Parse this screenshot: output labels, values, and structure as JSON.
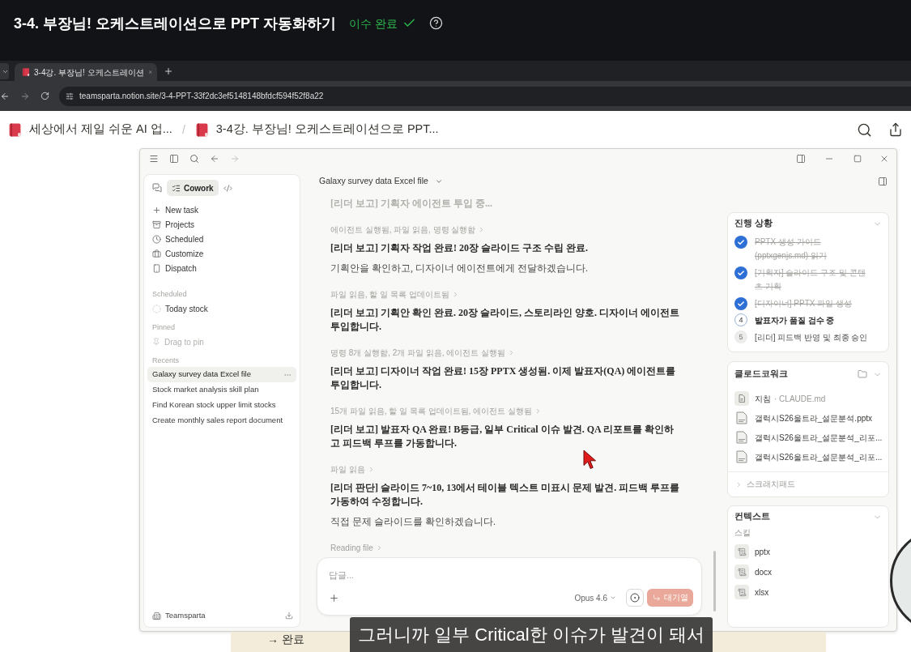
{
  "course_header": {
    "title": "3-4. 부장님! 오케스트레이션으로 PPT 자동화하기",
    "status": "이수 완료",
    "completed": true
  },
  "browser": {
    "tabs": [
      {
        "title": "3-4강. 부장님! 오케스트레이션",
        "selected": true
      }
    ],
    "url": "teamsparta.notion.site/3-4-PPT-33f2dc3ef5148148bfdcf594f52f8a22"
  },
  "notion_topbar": {
    "breadcrumbs": [
      "세상에서 제일 쉬운 AI 업...",
      "3-4강. 부장님! 오케스트레이션으로 PPT..."
    ],
    "separator": "/"
  },
  "app_sidebar": {
    "modes": [
      {
        "kind": "chat",
        "selected": false
      },
      {
        "kind": "cowork",
        "label": "Cowork",
        "selected": true
      },
      {
        "kind": "code",
        "selected": false
      }
    ],
    "nav": [
      "New task",
      "Projects",
      "Scheduled",
      "Customize",
      "Dispatch"
    ],
    "scheduled": {
      "heading": "Scheduled",
      "items": [
        "Today stock"
      ]
    },
    "pinned": {
      "heading": "Pinned",
      "hint": "Drag to pin"
    },
    "recents": {
      "heading": "Recents",
      "items": [
        {
          "label": "Galaxy survey data Excel file",
          "selected": true
        },
        {
          "label": "Stock market analysis skill plan",
          "selected": false
        },
        {
          "label": "Find Korean stock upper limit stocks",
          "selected": false
        },
        {
          "label": "Create monthly sales report document",
          "selected": false
        }
      ]
    },
    "workspace": "Teamsparta"
  },
  "chat": {
    "title": "Galaxy survey data Excel file",
    "messages": [
      {
        "kind": "faded",
        "text": "[리더 보고] 기획자 에이전트 투입 중..."
      },
      {
        "kind": "activity",
        "text": "에이전트 실행됨, 파일 읽음, 명령 실행함"
      },
      {
        "kind": "bold",
        "text": "[리더 보고] 기획자 작업 완료! 20장 슬라이드 구조 수립 완료."
      },
      {
        "kind": "plain",
        "text": "기획안을 확인하고, 디자이너 에이전트에게 전달하겠습니다."
      },
      {
        "kind": "activity",
        "text": "파일 읽음, 할 일 목록 업데이트됨"
      },
      {
        "kind": "bold",
        "text": "[리더 보고] 기획안 확인 완료. 20장 슬라이드, 스토리라인 양호. 디자이너 에이전트 투입합니다."
      },
      {
        "kind": "activity",
        "text": "명령 8개 실행함, 2개 파일 읽음, 에이전트 실행됨"
      },
      {
        "kind": "bold",
        "text": "[리더 보고] 디자이너 작업 완료! 15장 PPTX 생성됨. 이제 발표자(QA) 에이전트를 투입합니다."
      },
      {
        "kind": "activity",
        "text": "15개 파일 읽음, 할 일 목록 업데이트됨, 에이전트 실행됨"
      },
      {
        "kind": "bold",
        "text": "[리더 보고] 발표자 QA 완료! B등급, 일부 Critical 이슈 발견. QA 리포트를 확인하고 피드백 루프를 가동합니다."
      },
      {
        "kind": "activity",
        "text": "파일 읽음"
      },
      {
        "kind": "bold",
        "text": "[리더 판단] 슬라이드 7~10, 13에서 테이블 텍스트 미표시 문제 발견. 피드백 루프를 가동하여 수정합니다."
      },
      {
        "kind": "plain",
        "text": "직접 문제 슬라이드를 확인하겠습니다."
      },
      {
        "kind": "activity",
        "text": "Reading file"
      }
    ],
    "composer": {
      "placeholder": "답글...",
      "model": "Opus 4.6",
      "queue_button": "대기열"
    }
  },
  "side_panel": {
    "progress": {
      "title": "진행 상황",
      "steps": [
        {
          "kind": "done",
          "text": "PPTX 생성 가이드 (pptxgenjs.md) 읽기"
        },
        {
          "kind": "done",
          "text": "[기획자] 슬라이드 구조 및 콘텐츠 기획"
        },
        {
          "kind": "done",
          "text": "[디자이너] PPTX 파일 생성"
        },
        {
          "kind": "active",
          "number": "4",
          "text": "발표자가 품질 검수 중"
        },
        {
          "kind": "pending",
          "number": "5",
          "text": "[리더] 피드백 반영 및 최종 승인"
        }
      ]
    },
    "workspace_files": {
      "title": "클로드코워크",
      "files": [
        {
          "kind": "guide",
          "name": "지침",
          "detail": "· CLAUDE.md"
        },
        {
          "kind": "file",
          "name": "갤럭시S26울트라_설문분석.pptx"
        },
        {
          "kind": "file",
          "name": "갤럭시S26울트라_설문분석_리포..."
        },
        {
          "kind": "file",
          "name": "갤럭시S26울트라_설문분석_리포..."
        }
      ],
      "scratchpad": "스크래치패드"
    },
    "context": {
      "title": "컨텍스트",
      "group": "스킬",
      "skills": [
        "pptx",
        "docx",
        "xlsx"
      ]
    }
  },
  "page_below": {
    "text": "→ 완료"
  },
  "subtitle": "그러니까 일부 Critical한 이슈가 발견이 돼서"
}
